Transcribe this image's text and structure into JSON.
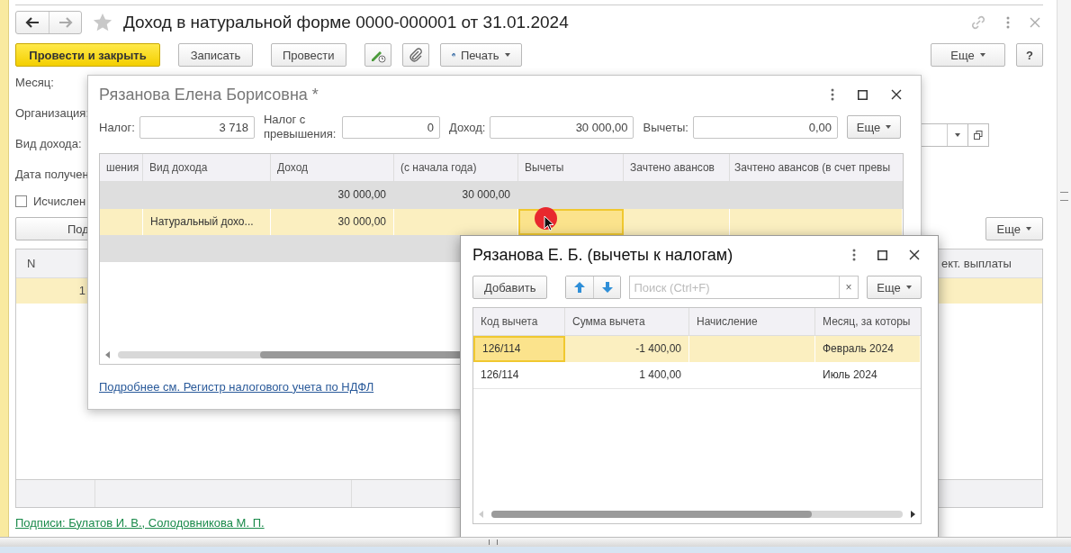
{
  "window": {
    "title": "Доход в натуральной форме 0000-000001 от 31.01.2024",
    "favorite": false
  },
  "toolbar": [
    {
      "kind": "primary",
      "label": "Провести и закрыть"
    },
    {
      "kind": "plain",
      "label": "Записать"
    },
    {
      "kind": "plain",
      "label": "Провести"
    },
    {
      "kind": "edit"
    },
    {
      "kind": "attach"
    },
    {
      "kind": "print",
      "label": "Печать"
    }
  ],
  "toolbar_right": {
    "more": "Еще",
    "help": "?"
  },
  "fields": [
    {
      "kind": "label",
      "label": "Месяц:"
    },
    {
      "kind": "label",
      "label": "Организация:"
    },
    {
      "kind": "select",
      "label": "Вид дохода:"
    },
    {
      "kind": "label",
      "label": "Дата получен"
    }
  ],
  "calculate_checkbox": {
    "label": "Исчислен",
    "checked": false
  },
  "table_toolbar": {
    "button": "Под",
    "more": "Еще"
  },
  "table": {
    "columns": [
      "N",
      "ект. выплаты"
    ],
    "rows": [
      {
        "number": "1",
        "selected": true
      }
    ]
  },
  "signatures_link": "Подписи: Булатов И. В., Солодовникова М. П.",
  "employee_dialog": {
    "title": "Рязанова Елена Борисовна *",
    "active": false,
    "fields": [
      {
        "label": "Налог:",
        "value": "3 718"
      },
      {
        "label": "Налог с превышения:",
        "value": "0"
      },
      {
        "label": "Доход:",
        "value": "30 000,00"
      },
      {
        "label": "Вычеты:",
        "value": "0,00"
      }
    ],
    "more": "Еще",
    "columns": [
      {
        "kind": "text",
        "label": "шения"
      },
      {
        "kind": "text",
        "label": "Вид дохода"
      },
      {
        "kind": "number",
        "label": "Доход"
      },
      {
        "kind": "number",
        "label": "(с начала года)"
      },
      {
        "kind": "number",
        "label": "Вычеты"
      },
      {
        "kind": "number",
        "label": "Зачтено авансов"
      },
      {
        "kind": "number",
        "label": "Зачтено авансов (в счет превы"
      }
    ],
    "rows": [
      {
        "kind": "total",
        "selected": false,
        "cells": [
          {
            "current": false
          },
          {
            "current": false
          },
          {
            "text": "30 000,00",
            "current": false
          },
          {
            "text": "30 000,00",
            "current": false
          },
          {
            "current": false
          },
          {
            "current": false
          },
          {
            "current": false
          }
        ]
      },
      {
        "kind": "data",
        "selected": true,
        "cells": [
          {
            "current": false
          },
          {
            "text": "Натуральный дохо...",
            "current": false
          },
          {
            "text": "30 000,00",
            "current": false
          },
          {
            "current": false
          },
          {
            "current": true
          },
          {
            "current": false
          },
          {
            "current": false
          }
        ]
      },
      {
        "kind": "total",
        "selected": false
      }
    ],
    "link": "Подробнее см. Регистр налогового учета по НДФЛ"
  },
  "deductions_dialog": {
    "title": "Рязанова Е. Б. (вычеты к налогам)",
    "active": true,
    "add": "Добавить",
    "search_placeholder": "Поиск (Ctrl+F)",
    "clear": "×",
    "more": "Еще",
    "columns": [
      {
        "kind": "text",
        "label": "Код вычета"
      },
      {
        "kind": "number",
        "label": "Сумма вычета"
      },
      {
        "kind": "text",
        "label": "Начисление"
      },
      {
        "kind": "text",
        "label": "Месяц, за которы"
      }
    ],
    "rows": [
      {
        "selected": true,
        "cells": [
          {
            "text": "126/114",
            "current": true
          },
          {
            "text": "-1 400,00",
            "current": false
          },
          {
            "current": false
          },
          {
            "text": "Февраль 2024",
            "current": false
          }
        ]
      },
      {
        "selected": false,
        "cells": [
          {
            "text": "126/114",
            "current": false
          },
          {
            "text": "1 400,00",
            "current": false
          },
          {
            "current": false
          },
          {
            "text": "Июль 2024",
            "current": false
          }
        ]
      }
    ]
  }
}
